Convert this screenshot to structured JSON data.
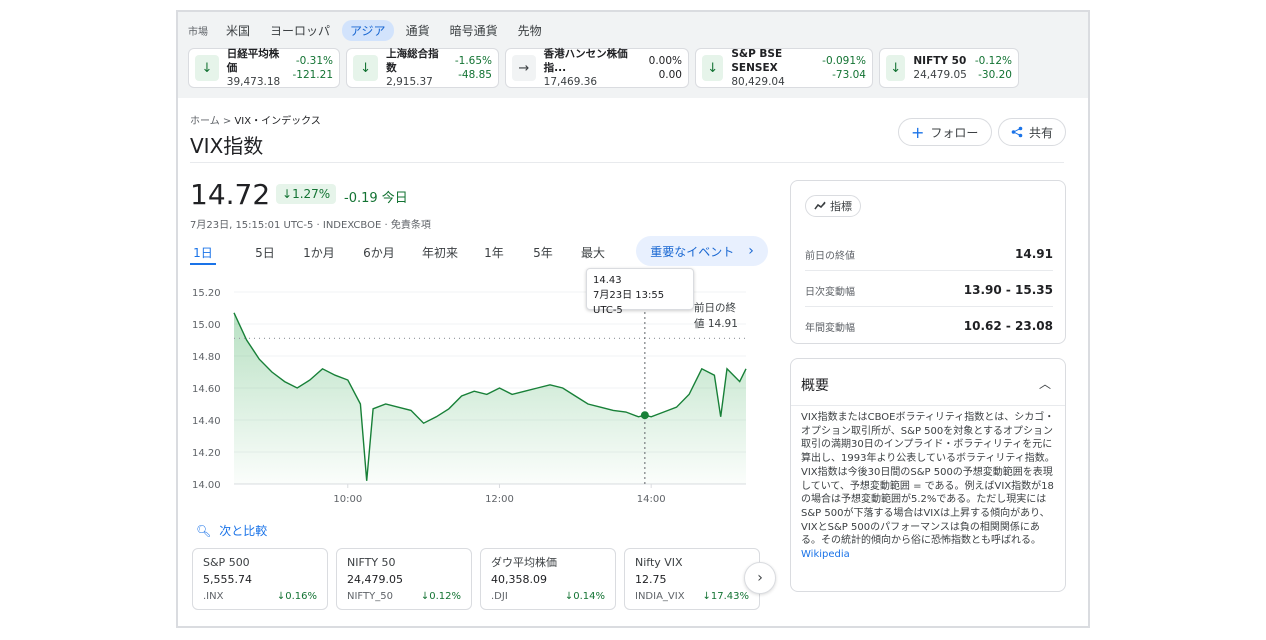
{
  "market": {
    "label": "市場",
    "tabs": [
      "米国",
      "ヨーロッパ",
      "アジア",
      "通貨",
      "暗号通貨",
      "先物"
    ],
    "active_tab": "アジア",
    "cards": [
      {
        "name": "日経平均株価",
        "value": "39,473.18",
        "pct": "-0.31%",
        "chg": "-121.21",
        "dir": "down"
      },
      {
        "name": "上海総合指数",
        "value": "2,915.37",
        "pct": "-1.65%",
        "chg": "-48.85",
        "dir": "down"
      },
      {
        "name": "香港ハンセン株価指...",
        "value": "17,469.36",
        "pct": "0.00%",
        "chg": "0.00",
        "dir": "flat"
      },
      {
        "name": "S&P BSE SENSEX",
        "value": "80,429.04",
        "pct": "-0.091%",
        "chg": "-73.04",
        "dir": "down"
      },
      {
        "name": "NIFTY 50",
        "value": "24,479.05",
        "pct": "-0.12%",
        "chg": "-30.20",
        "dir": "down"
      }
    ]
  },
  "breadcrumb": {
    "home": "ホーム",
    "current": "VIX・インデックス"
  },
  "title": "VIX指数",
  "buttons": {
    "follow": "フォロー",
    "share": "共有"
  },
  "quote": {
    "price": "14.72",
    "pct": "1.27%",
    "change": "-0.19 今日",
    "meta": "7月23日, 15:15:01 UTC-5 · INDEXCBOE · 免責条項"
  },
  "ranges": [
    "1日",
    "5日",
    "1か月",
    "6か月",
    "年初来",
    "1年",
    "5年",
    "最大"
  ],
  "events_button": "重要なイベント",
  "tooltip": {
    "value": "14.43",
    "time": "7月23日 13:55 UTC-5"
  },
  "prev_close_label": "前日の終値 14.91",
  "chart_data": {
    "type": "area",
    "yticks": [
      "15.20",
      "15.00",
      "14.80",
      "14.60",
      "14.40",
      "14.20",
      "14.00"
    ],
    "xticks": [
      "10:00",
      "12:00",
      "14:00"
    ],
    "ylim": [
      14.0,
      15.2
    ],
    "prev_close": 14.91,
    "x": [
      "08:30",
      "08:40",
      "08:50",
      "09:00",
      "09:10",
      "09:20",
      "09:30",
      "09:40",
      "09:50",
      "10:00",
      "10:10",
      "10:15",
      "10:20",
      "10:30",
      "10:40",
      "10:50",
      "11:00",
      "11:10",
      "11:20",
      "11:30",
      "11:40",
      "11:50",
      "12:00",
      "12:10",
      "12:20",
      "12:30",
      "12:40",
      "12:50",
      "13:00",
      "13:10",
      "13:20",
      "13:30",
      "13:40",
      "13:50",
      "13:55",
      "14:00",
      "14:10",
      "14:20",
      "14:30",
      "14:40",
      "14:50",
      "14:55",
      "15:00",
      "15:10",
      "15:15"
    ],
    "y": [
      15.07,
      14.9,
      14.78,
      14.7,
      14.64,
      14.6,
      14.65,
      14.72,
      14.68,
      14.65,
      14.5,
      14.02,
      14.47,
      14.5,
      14.48,
      14.46,
      14.38,
      14.42,
      14.47,
      14.55,
      14.58,
      14.56,
      14.6,
      14.56,
      14.58,
      14.6,
      14.62,
      14.6,
      14.55,
      14.5,
      14.48,
      14.46,
      14.45,
      14.42,
      14.43,
      14.42,
      14.45,
      14.48,
      14.56,
      14.72,
      14.68,
      14.42,
      14.72,
      14.64,
      14.72
    ]
  },
  "compare": {
    "label": "次と比較",
    "cards": [
      {
        "name": "S&P 500",
        "value": "5,555.74",
        "ticker": ".INX",
        "pct": "0.16%"
      },
      {
        "name": "NIFTY 50",
        "value": "24,479.05",
        "ticker": "NIFTY_50",
        "pct": "0.12%"
      },
      {
        "name": "ダウ平均株価",
        "value": "40,358.09",
        "ticker": ".DJI",
        "pct": "0.14%"
      },
      {
        "name": "Nifty VIX",
        "value": "12.75",
        "ticker": "INDIA_VIX",
        "pct": "17.43%"
      }
    ]
  },
  "stats": {
    "chip": "指標",
    "rows": [
      {
        "label": "前日の終値",
        "value": "14.91"
      },
      {
        "label": "日次変動幅",
        "value": "13.90 - 15.35"
      },
      {
        "label": "年間変動幅",
        "value": "10.62 - 23.08"
      }
    ]
  },
  "about": {
    "title": "概要",
    "text": "VIX指数またはCBOEボラティリティ指数とは、シカゴ・オプション取引所が、S&P 500を対象とするオプション取引の満期30日のインプライド・ボラティリティを元に算出し、1993年より公表しているボラティリティ指数。 VIX指数は今後30日間のS&P 500の予想変動範囲を表現していて、予想変動範囲 = である。例えばVIX指数が18の場合は予想変動範囲が5.2%である。ただし現実にはS&P 500が下落する場合はVIXは上昇する傾向があり、VIXとS&P 500のパフォーマンスは負の相関関係にある。その統計的傾向から俗に恐怖指数とも呼ばれる。",
    "link": "Wikipedia"
  }
}
